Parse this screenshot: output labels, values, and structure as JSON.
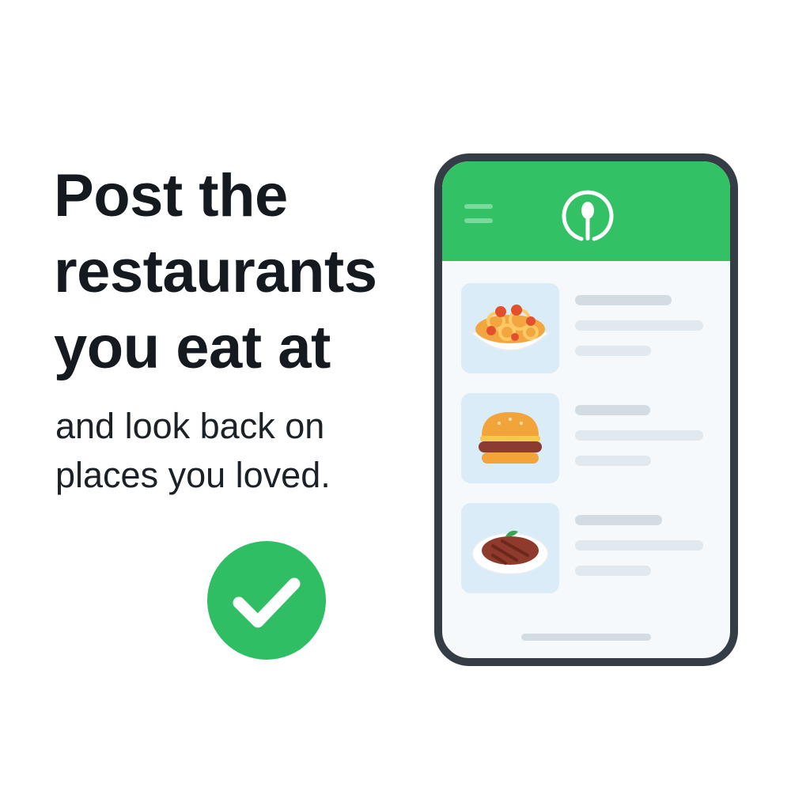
{
  "promo": {
    "headline": "Post the restaurants you eat at",
    "subline": "and look back on places you loved."
  },
  "badge": {
    "icon": "checkmark-icon",
    "color": "#2fbe64"
  },
  "phone": {
    "header": {
      "color": "#33c166",
      "menu_icon": "hamburger-menu-icon",
      "logo_icon": "spoon-pin-logo-icon"
    },
    "restaurants": [
      {
        "food_icon": "pasta-bowl-icon"
      },
      {
        "food_icon": "burger-icon"
      },
      {
        "food_icon": "steak-plate-icon"
      }
    ]
  },
  "colors": {
    "accent": "#33c166",
    "headline_text": "#141a1f",
    "phone_frame": "#343c45",
    "thumb_background": "#d9ecf7"
  }
}
